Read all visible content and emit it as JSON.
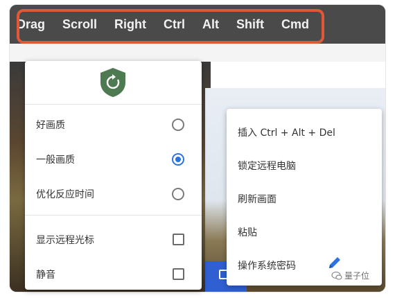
{
  "toolbar": {
    "keys": [
      "Drag",
      "Scroll",
      "Right",
      "Ctrl",
      "Alt",
      "Shift",
      "Cmd"
    ],
    "highlight_color": "#e0573a"
  },
  "quality_menu": {
    "header_icon": "shield-refresh-icon",
    "options": [
      {
        "label": "好画质",
        "selected": false
      },
      {
        "label": "一般画质",
        "selected": true
      },
      {
        "label": "优化反应时间",
        "selected": false
      }
    ],
    "toggles": [
      {
        "label": "显示远程光标",
        "checked": false
      },
      {
        "label": "静音",
        "checked": false
      }
    ],
    "accent_color": "#2b73e0"
  },
  "system_menu": {
    "items": [
      "插入 Ctrl + Alt + Del",
      "锁定远程电脑",
      "刷新画面",
      "粘贴",
      "操作系统密码"
    ]
  },
  "edit_icon": "pencil-icon",
  "watermark": {
    "text": "量子位"
  }
}
